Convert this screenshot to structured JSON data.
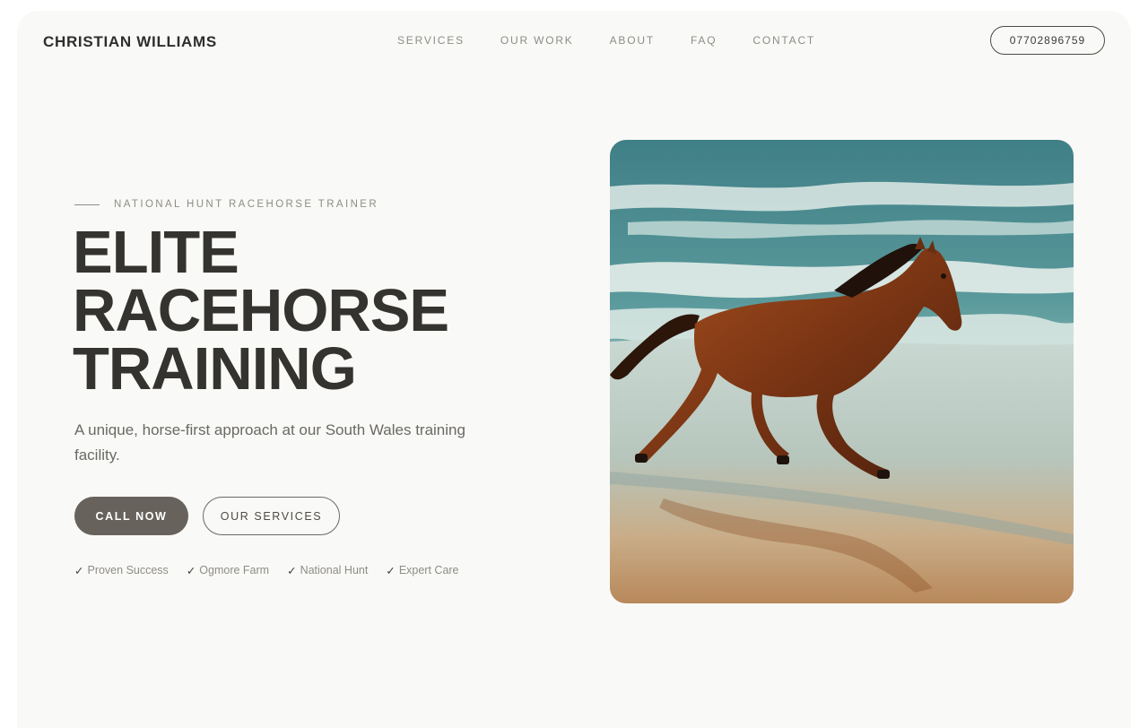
{
  "header": {
    "logo": "CHRISTIAN WILLIAMS",
    "nav": [
      "SERVICES",
      "OUR WORK",
      "ABOUT",
      "FAQ",
      "CONTACT"
    ],
    "phone": "07702896759"
  },
  "hero": {
    "eyebrow": "NATIONAL HUNT RACEHORSE TRAINER",
    "headline": [
      "ELITE",
      "RACEHORSE",
      "TRAINING"
    ],
    "lede": "A unique, horse-first approach at our South Wales training facility.",
    "primary_cta": "CALL NOW",
    "secondary_cta": "OUR SERVICES",
    "features": [
      "Proven Success",
      "Ogmore Farm",
      "National Hunt",
      "Expert Care"
    ],
    "check_glyph": "✓",
    "image": "photo of a chestnut horse galloping along a beach at the water's edge"
  },
  "colors": {
    "page_bg": "#f9f9f7",
    "heading": "#35332f",
    "muted": "#8e8c86",
    "primary_button": "#67625b"
  }
}
